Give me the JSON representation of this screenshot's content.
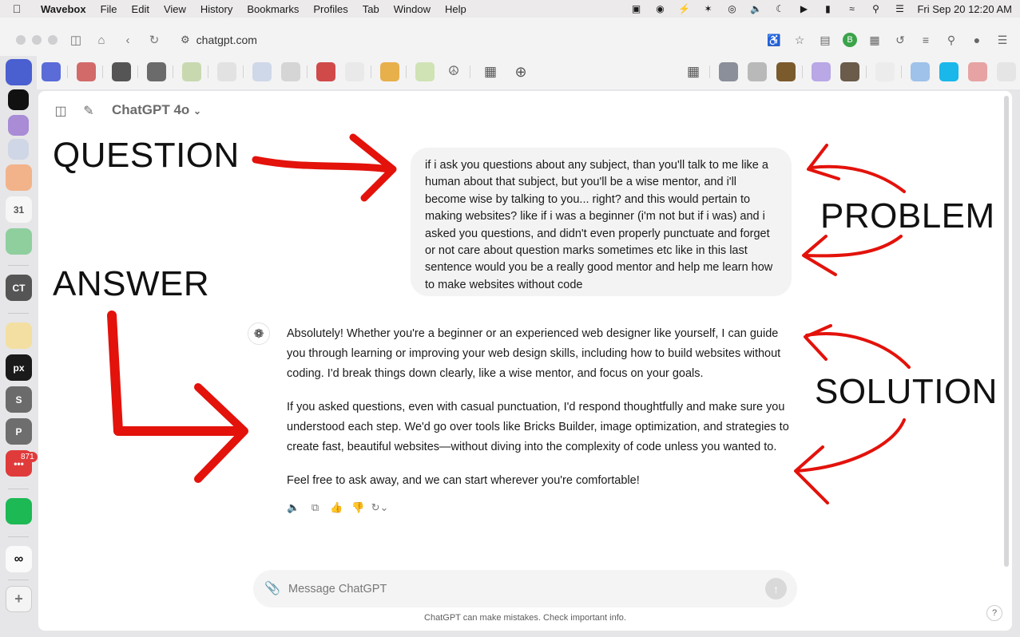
{
  "menubar": {
    "app": "Wavebox",
    "items": [
      "File",
      "Edit",
      "View",
      "History",
      "Bookmarks",
      "Profiles",
      "Tab",
      "Window",
      "Help"
    ],
    "clock": "Fri Sep 20  12:20 AM"
  },
  "browser": {
    "url": "chatgpt.com",
    "profile_initial": "B"
  },
  "rail": {
    "badge_count": "871"
  },
  "chat": {
    "model_label": "ChatGPT 4o",
    "user_message": "if i ask you questions about any subject, than you'll talk to me like a human about that subject, but you'll be a wise mentor, and i'll become wise by talking to you... right? and this would pertain to making websites? like if i was a beginner (i'm not but if i was) and i asked you questions, and didn't even properly punctuate and forget or not care about question marks sometimes etc like in this last sentence would you be a really good mentor and help me learn how to make websites without code",
    "answer_paragraphs": [
      "Absolutely! Whether you're a beginner or an experienced web designer like yourself, I can guide you through learning or improving your web design skills, including how to build websites without coding. I'd break things down clearly, like a wise mentor, and focus on your goals.",
      "If you asked questions, even with casual punctuation, I'd respond thoughtfully and make sure you understood each step. We'd go over tools like Bricks Builder, image optimization, and strategies to create fast, beautiful websites—without diving into the complexity of code unless you wanted to.",
      "Feel free to ask away, and we can start wherever you're comfortable!"
    ],
    "composer_placeholder": "Message ChatGPT",
    "disclaimer": "ChatGPT can make mistakes. Check important info.",
    "help_label": "?"
  },
  "annotations": {
    "question": "QUESTION",
    "answer": "ANSWER",
    "problem": "PROBLEM",
    "solution": "SOLUTION",
    "arrow_color": "#e3120b"
  },
  "icons": {
    "apple": "apple-logo-icon",
    "clip": "paperclip-icon",
    "send": "send-arrow-icon"
  }
}
